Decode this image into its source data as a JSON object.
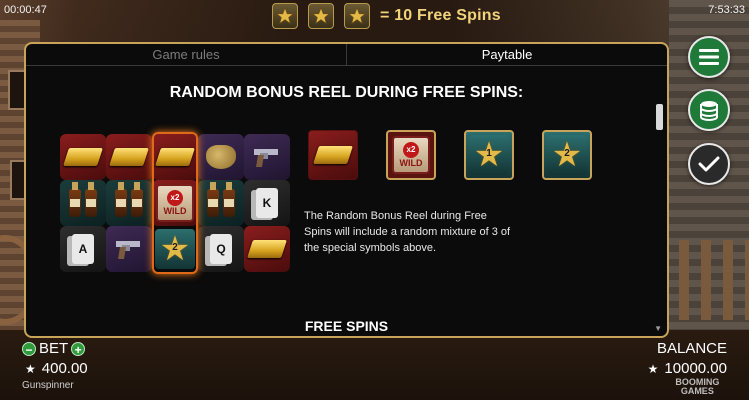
{
  "status_bar": {
    "session_time": "00:00:47",
    "clock": "7:53:33"
  },
  "banner": {
    "text": "= 10 Free Spins",
    "star_count": 3
  },
  "tabs": [
    {
      "label": "Game rules",
      "active": false
    },
    {
      "label": "Paytable",
      "active": true
    }
  ],
  "paytable": {
    "section_title": "RANDOM BONUS REEL DURING FREE SPINS:",
    "reel_grid": [
      [
        "gold-bar",
        "gold-bar",
        "gold-bar",
        "money-bag",
        "revolver"
      ],
      [
        "whiskey-bottles",
        "whiskey-bottles",
        "wild-x2",
        "whiskey-bottles",
        "card-k"
      ],
      [
        "card-a",
        "revolver",
        "scatter-2",
        "card-q",
        "gold-bar"
      ]
    ],
    "grid_labels": {
      "wild": "WILD",
      "wild_multiplier": "x2",
      "scatter": "SCATTER",
      "k": "K",
      "a": "A",
      "q": "Q",
      "scatter_num": "2"
    },
    "special_symbols": [
      {
        "name": "gold-bar"
      },
      {
        "name": "wild-x2",
        "label": "WILD",
        "multiplier": "x2"
      },
      {
        "name": "scatter-1",
        "label": "SCATTER",
        "number": "1"
      },
      {
        "name": "scatter-2",
        "label": "SCATTER",
        "number": "2"
      }
    ],
    "description": "The Random Bonus Reel during Free Spins will include a random mixture of 3 of the special symbols above.",
    "next_section_title": "FREE SPINS"
  },
  "side_buttons": [
    {
      "name": "menu-icon"
    },
    {
      "name": "coins-icon"
    },
    {
      "name": "check-icon"
    }
  ],
  "bet": {
    "label": "BET",
    "minus": "−",
    "plus": "+",
    "value": "400.00"
  },
  "game_name": "Gunspinner",
  "balance": {
    "label": "BALANCE",
    "value": "10000.00"
  },
  "brand": {
    "line1": "BOOMING",
    "line2": "GAMES"
  },
  "colors": {
    "panel_border": "#c8a35a",
    "button_green": "#1f7a3a",
    "banner_text": "#f1d37a",
    "reel_highlight": "#e06a1a"
  }
}
